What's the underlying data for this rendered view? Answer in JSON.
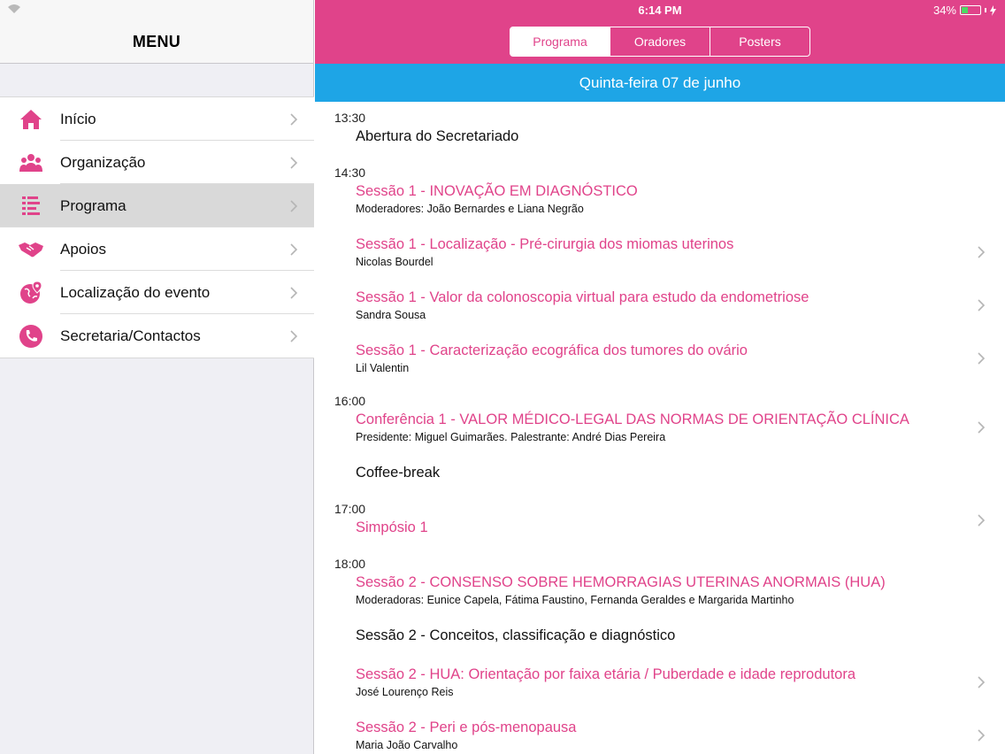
{
  "status": {
    "time": "6:14 PM",
    "battery": "34%"
  },
  "sidebar": {
    "title": "MENU",
    "items": [
      {
        "label": "Início",
        "icon": "home-icon",
        "active": false
      },
      {
        "label": "Organização",
        "icon": "people-icon",
        "active": false
      },
      {
        "label": "Programa",
        "icon": "list-icon",
        "active": true
      },
      {
        "label": "Apoios",
        "icon": "handshake-icon",
        "active": false
      },
      {
        "label": "Localização do evento",
        "icon": "globe-pin-icon",
        "active": false
      },
      {
        "label": "Secretaria/Contactos",
        "icon": "phone-icon",
        "active": false
      }
    ]
  },
  "tabs": [
    {
      "label": "Programa",
      "active": true
    },
    {
      "label": "Oradores",
      "active": false
    },
    {
      "label": "Posters",
      "active": false
    }
  ],
  "date": "Quinta-feira 07 de junho",
  "times": [
    "13:30",
    "14:30",
    "16:00",
    "17:00",
    "18:00"
  ],
  "entries": [
    {
      "title": "Abertura do Secretariado",
      "sub": ""
    },
    {
      "title": "Sessão 1 - INOVAÇÃO EM DIAGNÓSTICO",
      "sub": "Moderadores: João Bernardes e Liana Negrão"
    },
    {
      "title": "Sessão 1 - Localização - Pré-cirurgia dos miomas uterinos",
      "sub": "Nicolas Bourdel"
    },
    {
      "title": "Sessão 1 - Valor da colonoscopia virtual para estudo da endometriose",
      "sub": "Sandra Sousa"
    },
    {
      "title": "Sessão 1 - Caracterização ecográfica dos tumores do ovário",
      "sub": "Lil Valentin"
    },
    {
      "title": "Conferência 1 - VALOR MÉDICO-LEGAL DAS NORMAS DE ORIENTAÇÃO CLÍNICA",
      "sub": "Presidente: Miguel Guimarães. Palestrante: André Dias Pereira"
    },
    {
      "title": "Coffee-break",
      "sub": ""
    },
    {
      "title": "Simpósio 1",
      "sub": ""
    },
    {
      "title": "Sessão 2 - CONSENSO SOBRE HEMORRAGIAS UTERINAS ANORMAIS (HUA)",
      "sub": "Moderadoras: Eunice Capela, Fátima Faustino, Fernanda Geraldes e Margarida Martinho"
    },
    {
      "title": "Sessão 2 - Conceitos, classificação e diagnóstico",
      "sub": ""
    },
    {
      "title": "Sessão 2 - HUA: Orientação por faixa etária / Puberdade e idade reprodutora",
      "sub": "José Lourenço Reis"
    },
    {
      "title": "Sessão 2 - Peri e pós-menopausa",
      "sub": "Maria João Carvalho"
    }
  ],
  "colors": {
    "accent": "#e0438a",
    "datebar": "#1ea5e6"
  }
}
